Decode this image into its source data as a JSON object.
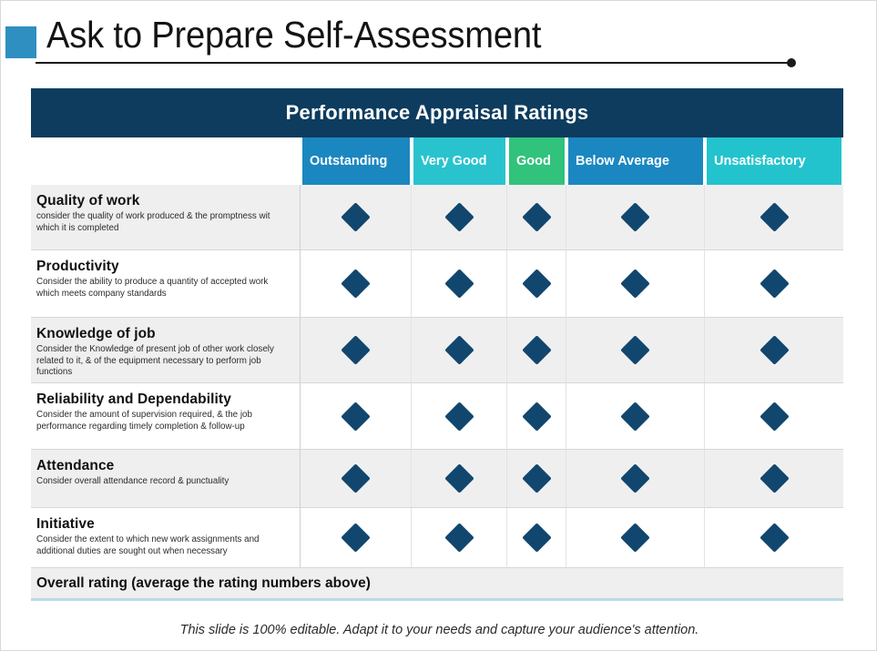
{
  "slide": {
    "title": "Ask to Prepare Self-Assessment",
    "accent_color": "#2f8fc0",
    "footer_note": "This slide is 100% editable. Adapt it to your needs and capture your audience's attention."
  },
  "table": {
    "banner_title": "Performance Appraisal Ratings",
    "banner_color": "#0d3c5e",
    "blank_corner": "",
    "columns": [
      {
        "label": "Outstanding",
        "color": "#1b87c0"
      },
      {
        "label": "Very Good",
        "color": "#29c3ce"
      },
      {
        "label": "Good",
        "color": "#31c27c"
      },
      {
        "label": "Below Average",
        "color": "#1b87c0"
      },
      {
        "label": "Unsatisfactory",
        "color": "#23c3cd"
      }
    ],
    "marker_color": "#11466e",
    "rows": [
      {
        "title": "Quality  of work",
        "desc": "consider the quality of work produced & the promptness wit which it is completed",
        "ratings": [
          "diamond",
          "diamond",
          "diamond",
          "diamond",
          "diamond"
        ]
      },
      {
        "title": "Productivity",
        "desc": "Consider the ability to produce a quantity of accepted work which meets company standards",
        "ratings": [
          "diamond",
          "diamond",
          "diamond",
          "diamond",
          "diamond"
        ]
      },
      {
        "title": "Knowledge of job",
        "desc": "Consider the Knowledge of present job of other work closely related to it, & of the equipment necessary to perform job functions",
        "ratings": [
          "diamond",
          "diamond",
          "diamond",
          "diamond",
          "diamond"
        ]
      },
      {
        "title": "Reliability  and Dependability",
        "desc": "Consider the amount of supervision required,  & the job performance regarding  timely completion & follow-up",
        "ratings": [
          "diamond",
          "diamond",
          "diamond",
          "diamond",
          "diamond"
        ]
      },
      {
        "title": "Attendance",
        "desc": "Consider overall attendance record & punctuality",
        "ratings": [
          "diamond",
          "diamond",
          "diamond",
          "diamond",
          "diamond"
        ]
      },
      {
        "title": "Initiative",
        "desc": "Consider the extent to which new work assignments and additional duties are sought out when necessary",
        "ratings": [
          "diamond",
          "diamond",
          "diamond",
          "diamond",
          "diamond"
        ]
      }
    ],
    "overall_label": "Overall rating (average the rating numbers above)"
  }
}
